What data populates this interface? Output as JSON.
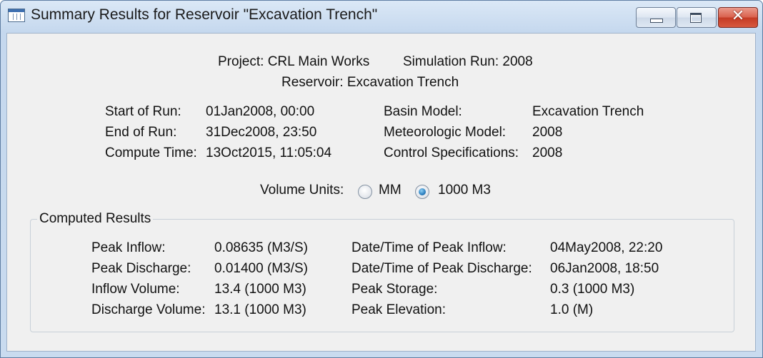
{
  "window": {
    "title": "Summary Results for Reservoir \"Excavation Trench\"",
    "controls": {
      "minimize": "minimize",
      "maximize": "maximize",
      "close": "✕"
    }
  },
  "header": {
    "project_label": "Project: CRL Main Works",
    "run_label": "Simulation Run: 2008",
    "reservoir_label": "Reservoir: Excavation Trench"
  },
  "run_info": {
    "left": [
      {
        "label": "Start of Run:",
        "value": "01Jan2008, 00:00"
      },
      {
        "label": "End of Run:",
        "value": "31Dec2008, 23:50"
      },
      {
        "label": "Compute Time:",
        "value": "13Oct2015, 11:05:04"
      }
    ],
    "right": [
      {
        "label": "Basin Model:",
        "value": "Excavation Trench"
      },
      {
        "label": "Meteorologic Model:",
        "value": "2008"
      },
      {
        "label": "Control Specifications:",
        "value": "2008"
      }
    ]
  },
  "volume_units": {
    "label": "Volume Units:",
    "options": [
      {
        "label": "MM",
        "selected": false
      },
      {
        "label": "1000 M3",
        "selected": true
      }
    ]
  },
  "computed_results": {
    "title": "Computed Results",
    "left": [
      {
        "label": "Peak Inflow:",
        "value": "0.08635 (M3/S)"
      },
      {
        "label": "Peak Discharge:",
        "value": "0.01400 (M3/S)"
      },
      {
        "label": "Inflow Volume:",
        "value": "13.4 (1000 M3)"
      },
      {
        "label": "Discharge Volume:",
        "value": "13.1 (1000 M3)"
      }
    ],
    "right": [
      {
        "label": "Date/Time of Peak Inflow:",
        "value": "04May2008, 22:20"
      },
      {
        "label": "Date/Time of Peak Discharge:",
        "value": "06Jan2008, 18:50"
      },
      {
        "label": "Peak Storage:",
        "value": "0.3 (1000 M3)"
      },
      {
        "label": "Peak Elevation:",
        "value": "1.0 (M)"
      }
    ]
  },
  "colors": {
    "titlebar": "#c5d8ee",
    "close_button": "#c43a24",
    "client": "#f0f0f0",
    "radio_selected": "#2b7fbf"
  }
}
